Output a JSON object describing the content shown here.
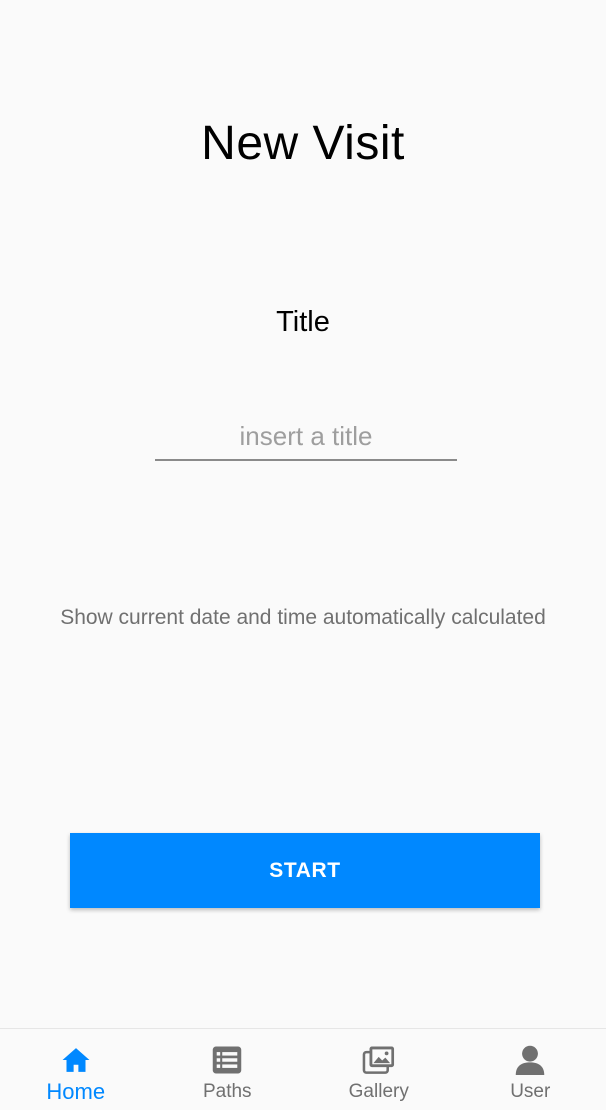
{
  "page": {
    "title": "New Visit"
  },
  "form": {
    "title_label": "Title",
    "title_placeholder": "insert a title",
    "title_value": "",
    "datetime_text": "Show current date and time automatically calculated",
    "start_label": "START"
  },
  "tab_bar": {
    "tabs": [
      {
        "label": "Home",
        "icon": "home-icon",
        "active": true
      },
      {
        "label": "Paths",
        "icon": "list-icon",
        "active": false
      },
      {
        "label": "Gallery",
        "icon": "gallery-icon",
        "active": false
      },
      {
        "label": "User",
        "icon": "user-icon",
        "active": false
      }
    ]
  },
  "colors": {
    "accent": "#0088ff",
    "inactive": "#707070",
    "background": "#fafafa"
  }
}
